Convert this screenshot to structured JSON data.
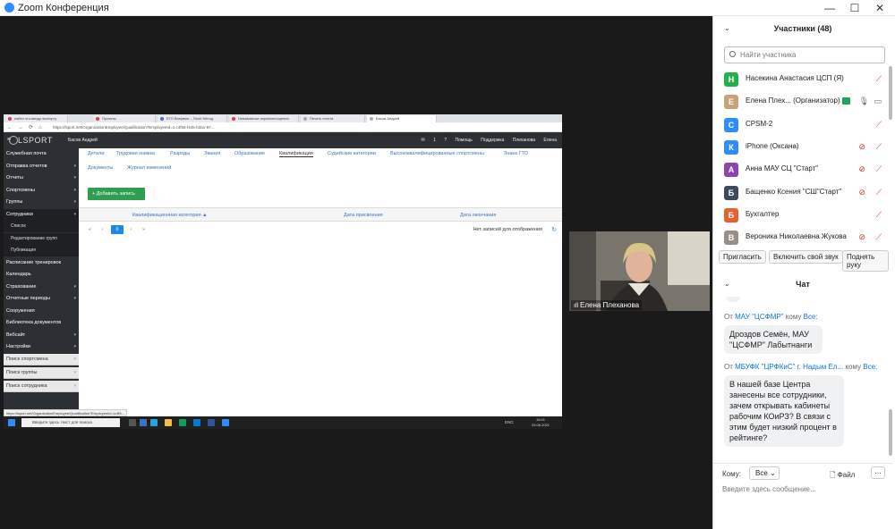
{
  "window": {
    "title": "Zoom Конференция",
    "controls": [
      "—",
      "☐",
      "✕"
    ]
  },
  "browser": {
    "tabs": [
      {
        "label": "найти что-вводу экспорту",
        "color": "#e04040"
      },
      {
        "label": "Проекты",
        "color": "#e04040"
      },
      {
        "label": "ЕГО Впервые – Поле Метод",
        "color": "#3b74c5"
      },
      {
        "label": "Невзаимные перевоплощения",
        "color": "#e04040"
      },
      {
        "label": "Печать отчета",
        "color": "#aaaaaa"
      },
      {
        "label": "Басов Андрей",
        "color": "#aaaaaa"
      }
    ],
    "url": "https://lsport.net/OrganizationEmployee/Qualification?EmployeeId=1.c4f55-f445-b3a1-97..."
  },
  "lsport": {
    "brand": "LSPORT",
    "user": "Басов Андрей",
    "right_items": "✉ 1   ? Помощь   Поддержка   Плеханова Елена",
    "sidebar": [
      {
        "label": "Служебная почта",
        "caret": false,
        "kind": "main"
      },
      {
        "label": "Отправка отчетов",
        "caret": true,
        "kind": "main"
      },
      {
        "label": "Отчеты",
        "caret": true,
        "kind": "main"
      },
      {
        "label": "Спортсмены",
        "caret": true,
        "kind": "main"
      },
      {
        "label": "Группы",
        "caret": true,
        "kind": "main"
      },
      {
        "label": "Сотрудники",
        "caret": true,
        "kind": "act"
      },
      {
        "label": "Список",
        "caret": false,
        "kind": "sub"
      },
      {
        "label": "Редактирование групп",
        "caret": false,
        "kind": "sub"
      },
      {
        "label": "Публикация",
        "caret": false,
        "kind": "sub"
      },
      {
        "label": "Расписание тренировок",
        "caret": false,
        "kind": "main"
      },
      {
        "label": "Календарь",
        "caret": false,
        "kind": "main"
      },
      {
        "label": "Страхование",
        "caret": true,
        "kind": "main"
      },
      {
        "label": "Отчетные периоды",
        "caret": true,
        "kind": "main"
      },
      {
        "label": "Сооружения",
        "caret": false,
        "kind": "main"
      },
      {
        "label": "Библиотека документов",
        "caret": false,
        "kind": "main"
      },
      {
        "label": "Вебсайт",
        "caret": true,
        "kind": "main"
      },
      {
        "label": "Настройки",
        "caret": true,
        "kind": "main"
      },
      {
        "label": "Поиск спортсмена",
        "caret": true,
        "kind": "search"
      },
      {
        "label": "Поиск группы",
        "caret": true,
        "kind": "search"
      },
      {
        "label": "Поиск сотрудника",
        "caret": true,
        "kind": "search"
      }
    ],
    "tabs_row1": [
      "Детали",
      "Трудовая книжка",
      "Разряды",
      "Звания",
      "Образование",
      "Квалификация",
      "Судейские категории",
      "Высококвалифицированные спортсмены",
      "Знака ГТО"
    ],
    "tabs_row2": [
      "Документы",
      "Журнал изменений"
    ],
    "selected_tab": "Квалификация",
    "add_button": "+ Добавить запись",
    "columns": [
      "Квалификационная категория ▲",
      "Дата присвоения",
      "Дата окончания"
    ],
    "pager": [
      "«",
      "‹",
      "0",
      "›",
      "»"
    ],
    "empty_text": "Нет записей для отображения",
    "status_url": "https://lsport.net/OrganizationEmployee/Qualification?EmployeeId=1c4f5..."
  },
  "taskbar": {
    "search": "Введите здесь текст для поиска",
    "time": "15:01",
    "date": "29.06.2021",
    "lang": "ENG"
  },
  "video": {
    "name": "Елена Плеханова"
  },
  "participants": {
    "title": "Участники (48)",
    "search_placeholder": "Найти участника",
    "list": [
      {
        "letter": "Н",
        "color": "#22b14c",
        "name": "Насекина Анастасия ЦСП (Я)",
        "mic_off": true,
        "cam_off": false,
        "mic_on": false,
        "host": false
      },
      {
        "letter": "Е",
        "color": "#c9a27a",
        "name": "Елена Плех... (Организатор)",
        "mic_off": false,
        "cam_off": false,
        "mic_on": true,
        "host": true
      },
      {
        "letter": "С",
        "color": "#2d8cff",
        "name": "CPSM-2",
        "mic_off": true,
        "cam_off": false,
        "mic_on": false,
        "host": false
      },
      {
        "letter": "К",
        "color": "#2d8cff",
        "name": "iPhone (Оксана)",
        "mic_off": true,
        "cam_off": true,
        "mic_on": false,
        "host": false
      },
      {
        "letter": "А",
        "color": "#8e44ad",
        "name": "Анна МАУ СЦ \"Старт\"",
        "mic_off": true,
        "cam_off": true,
        "mic_on": false,
        "host": false
      },
      {
        "letter": "Б",
        "color": "#3d4a5c",
        "name": "Бащенко Ксения \"СШ\"Старт\"",
        "mic_off": true,
        "cam_off": true,
        "mic_on": false,
        "host": false
      },
      {
        "letter": "Б",
        "color": "#e8602c",
        "name": "Бухгалтер",
        "mic_off": true,
        "cam_off": false,
        "mic_on": false,
        "host": false
      },
      {
        "letter": "В",
        "color": "#9a8f86",
        "name": "Вероника Николаевна Жукова",
        "mic_off": true,
        "cam_off": true,
        "mic_on": false,
        "host": false
      }
    ],
    "buttons": [
      "Пригласить",
      "Включить свой звук",
      "Поднять руку"
    ]
  },
  "chat": {
    "title": "Чат",
    "messages": [
      {
        "from": "МАУ \"ЦСФМР\"",
        "to": "Все:",
        "text": "Дроздов Семён, МАУ \"ЦСФМР\" Лабытнанги"
      },
      {
        "from": "МБУФК \"ЦРФКиС\" г. Надым Ел...",
        "to": "Все:",
        "text": "В нашей базе Центра занесены все сотрудники, зачем открывать кабинеты рабочим КОиРЗ? В связи с этим будет низкий процент в рейтинге?"
      }
    ],
    "from_prefix": "От",
    "to_word": "кому",
    "to_label": "Кому:",
    "to_value": "Все",
    "file_label": "Файл",
    "placeholder": "Введите здесь сообщение..."
  }
}
